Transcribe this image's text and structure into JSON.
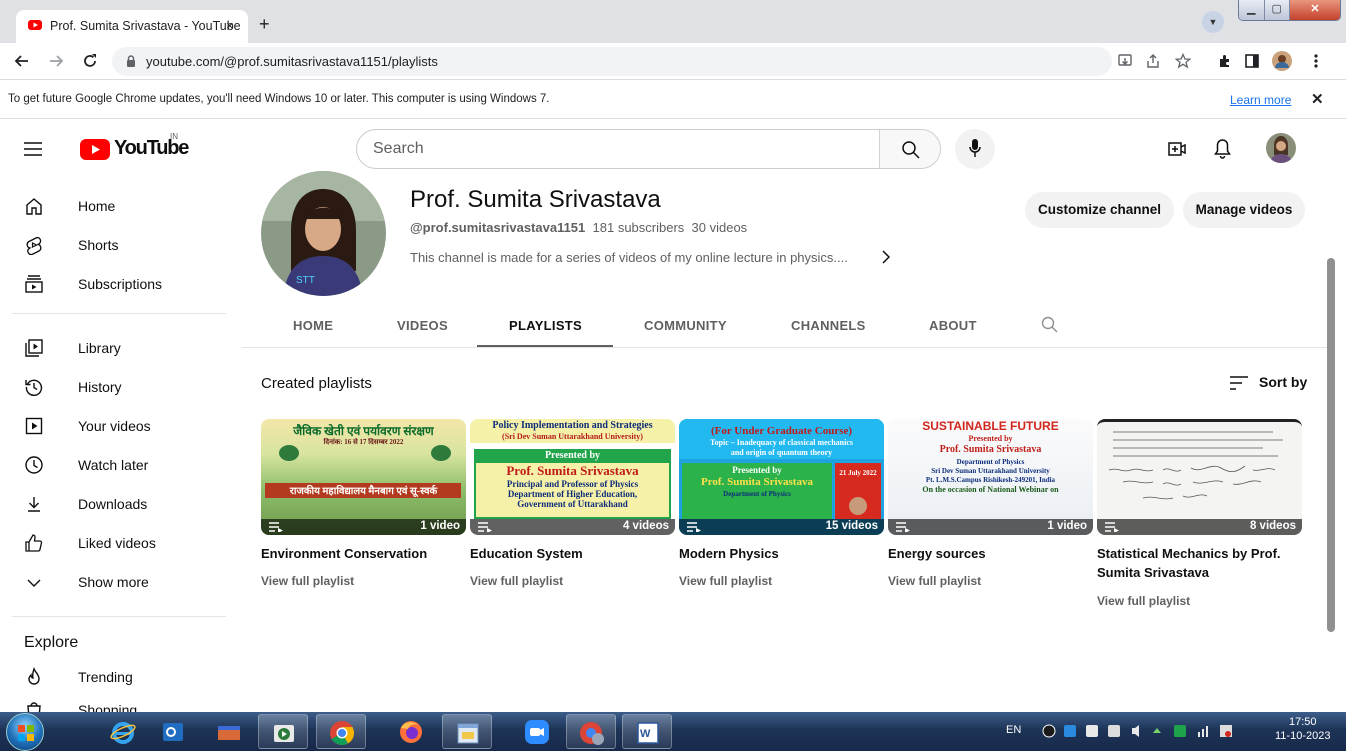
{
  "browser": {
    "tab_title": "Prof. Sumita Srivastava - YouTube",
    "tab_close": "×",
    "new_tab": "+",
    "url": "youtube.com/@prof.sumitasrivastava1151/playlists",
    "infobar_message": "To get future Google Chrome updates, you'll need Windows 10 or later. This computer is using Windows 7.",
    "infobar_link": "Learn more",
    "infobar_close": "✕"
  },
  "youtube": {
    "logo_text": "YouTube",
    "country_code": "IN",
    "search_placeholder": "Search"
  },
  "sidebar": {
    "items": [
      {
        "label": "Home"
      },
      {
        "label": "Shorts"
      },
      {
        "label": "Subscriptions"
      },
      {
        "label": "Library"
      },
      {
        "label": "History"
      },
      {
        "label": "Your videos"
      },
      {
        "label": "Watch later"
      },
      {
        "label": "Downloads"
      },
      {
        "label": "Liked videos"
      },
      {
        "label": "Show more"
      }
    ],
    "explore_heading": "Explore",
    "explore_items": [
      {
        "label": "Trending"
      },
      {
        "label": "Shopping"
      }
    ]
  },
  "channel": {
    "name": "Prof. Sumita Srivastava",
    "handle": "@prof.sumitasrivastava1151",
    "subscribers": "181 subscribers",
    "videos": "30 videos",
    "description": "This channel is made for a series of videos of my online lecture in physics....",
    "customize_label": "Customize channel",
    "manage_label": "Manage videos"
  },
  "tabs": [
    {
      "label": "HOME"
    },
    {
      "label": "VIDEOS"
    },
    {
      "label": "PLAYLISTS"
    },
    {
      "label": "COMMUNITY"
    },
    {
      "label": "CHANNELS"
    },
    {
      "label": "ABOUT"
    }
  ],
  "active_tab": "PLAYLISTS",
  "playlists_section": {
    "heading": "Created playlists",
    "sort_label": "Sort by",
    "view_full_label": "View full playlist"
  },
  "playlists": [
    {
      "name": "Environment Conservation",
      "count": "1 video",
      "thumb_text": [
        "जैविक खेती एवं पर्यावरण संरक्षण",
        "दिनांक: 16 से 17 दिसम्बर 2022",
        "राजकीय महाविद्यालय मैनबाग एवं सू-स्वर्क"
      ]
    },
    {
      "name": "Education System",
      "count": "4 videos",
      "thumb_text": [
        "Policy Implementation and Strategies",
        "(Sri Dev Suman Uttarakhand University)",
        "Presented by",
        "Prof. Sumita Srivastava",
        "Principal and Professor of Physics",
        "Department of Higher Education,",
        "Government of Uttarakhand"
      ]
    },
    {
      "name": "Modern Physics",
      "count": "15 videos",
      "thumb_text": [
        "(For Under Graduate Course)",
        "Topic – Inadequacy of classical mechanics",
        "and origin of quantum theory",
        "Presented by",
        "Prof. Sumita Srivastava",
        "Department of Physics",
        "21 July 2022"
      ]
    },
    {
      "name": "Energy sources",
      "count": "1 video",
      "thumb_text": [
        "SUSTAINABLE FUTURE",
        "Presented by",
        "Prof. Sumita Srivastava",
        "Department of Physics",
        "Sri Dev Suman Uttarakhand University",
        "Pt. L.M.S.Campus Rishikesh-249201, India",
        "On the occasion of National Webinar on"
      ]
    },
    {
      "name": "Statistical Mechanics by Prof. Sumita Srivastava",
      "count": "8 videos",
      "thumb_text": []
    }
  ],
  "taskbar": {
    "language": "EN",
    "time": "17:50",
    "date": "11-10-2023"
  },
  "colors": {
    "youtube_red": "#ff0000",
    "chrome_link": "#1a73e8",
    "taskbar": "#1d3457"
  }
}
